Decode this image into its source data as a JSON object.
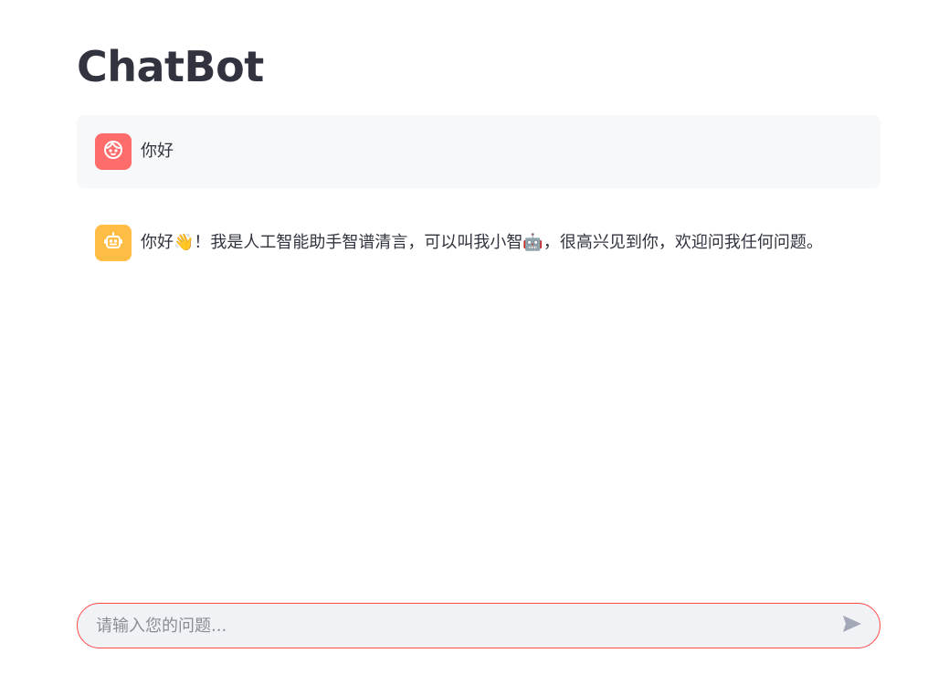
{
  "app": {
    "title": "ChatBot"
  },
  "messages": [
    {
      "role": "user",
      "avatar_icon": "user-face-icon",
      "text": "你好"
    },
    {
      "role": "assistant",
      "avatar_icon": "robot-icon",
      "text": "你好👋！我是人工智能助手智谱清言，可以叫我小智🤖，很高兴见到你，欢迎问我任何问题。"
    }
  ],
  "chat_input": {
    "placeholder": "请输入您的问题...",
    "value": "",
    "send_icon": "send-icon"
  },
  "colors": {
    "user_avatar": "#ff6c6c",
    "bot_avatar": "#ffbd45",
    "input_border": "#ff4b4b",
    "user_message_bg": "#f7f8fa",
    "input_bg": "#f0f2f6"
  }
}
